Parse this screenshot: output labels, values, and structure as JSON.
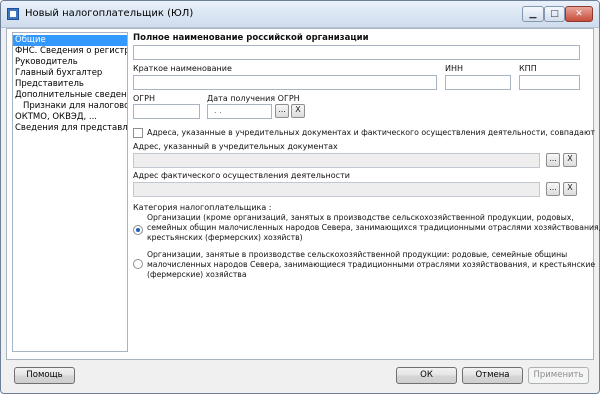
{
  "window": {
    "title": "Новый налогоплательщик (ЮЛ)",
    "controls": {
      "minimize": "▁",
      "maximize": "□",
      "close": "✕"
    }
  },
  "nav": {
    "items": [
      {
        "label": "Общие",
        "selected": true
      },
      {
        "label": "ФНС. Сведения о регистрации"
      },
      {
        "label": "Руководитель"
      },
      {
        "label": "Главный бухгалтер"
      },
      {
        "label": "Представитель"
      },
      {
        "label": "Дополнительные сведения"
      },
      {
        "label": "Признаки для налоговой",
        "sub": true
      },
      {
        "label": "ОКТМО, ОКВЭД, ..."
      },
      {
        "label": "Сведения для представления"
      }
    ]
  },
  "form": {
    "full_name_label": "Полное наименование российской организации",
    "full_name_value": "",
    "short_name_label": "Краткое наименование",
    "short_name_value": "",
    "inn_label": "ИНН",
    "inn_value": "",
    "kpp_label": "КПП",
    "kpp_value": "",
    "ogrn_label": "ОГРН",
    "ogrn_value": "",
    "ogrn_date_label": "Дата получения ОГРН",
    "ogrn_date_value": ". .",
    "same_address_label": "Адреса, указанные в учредительных документах и фактического осуществления деятельности, совпадают",
    "same_address_checked": false,
    "legal_address_label": "Адрес, указанный в учредительных документах",
    "actual_address_label": "Адрес фактического осуществления деятельности",
    "category_label": "Категория налогоплательщика :",
    "category_option1_lines": [
      "Организации (кроме организаций, занятых в производстве сельскохозяйственной продукции, родовых,",
      "семейных общин малочисленных народов Севера, занимающихся традиционными отраслями хозяйствования, и",
      "крестьянских (фермерских) хозяйств)"
    ],
    "category_option2_lines": [
      "Организации, занятые в производстве сельскохозяйственной продукции: родовые, семейные общины",
      "малочисленных народов Севера, занимающиеся традиционными отраслями хозяйствования, и крестьянские",
      "(фермерские) хозяйства"
    ],
    "selected_category": 1,
    "browse_button": "...",
    "clear_button": "X"
  },
  "footer": {
    "help": "Помощь",
    "ok": "ОК",
    "cancel": "Отмена",
    "apply": "Применить"
  }
}
